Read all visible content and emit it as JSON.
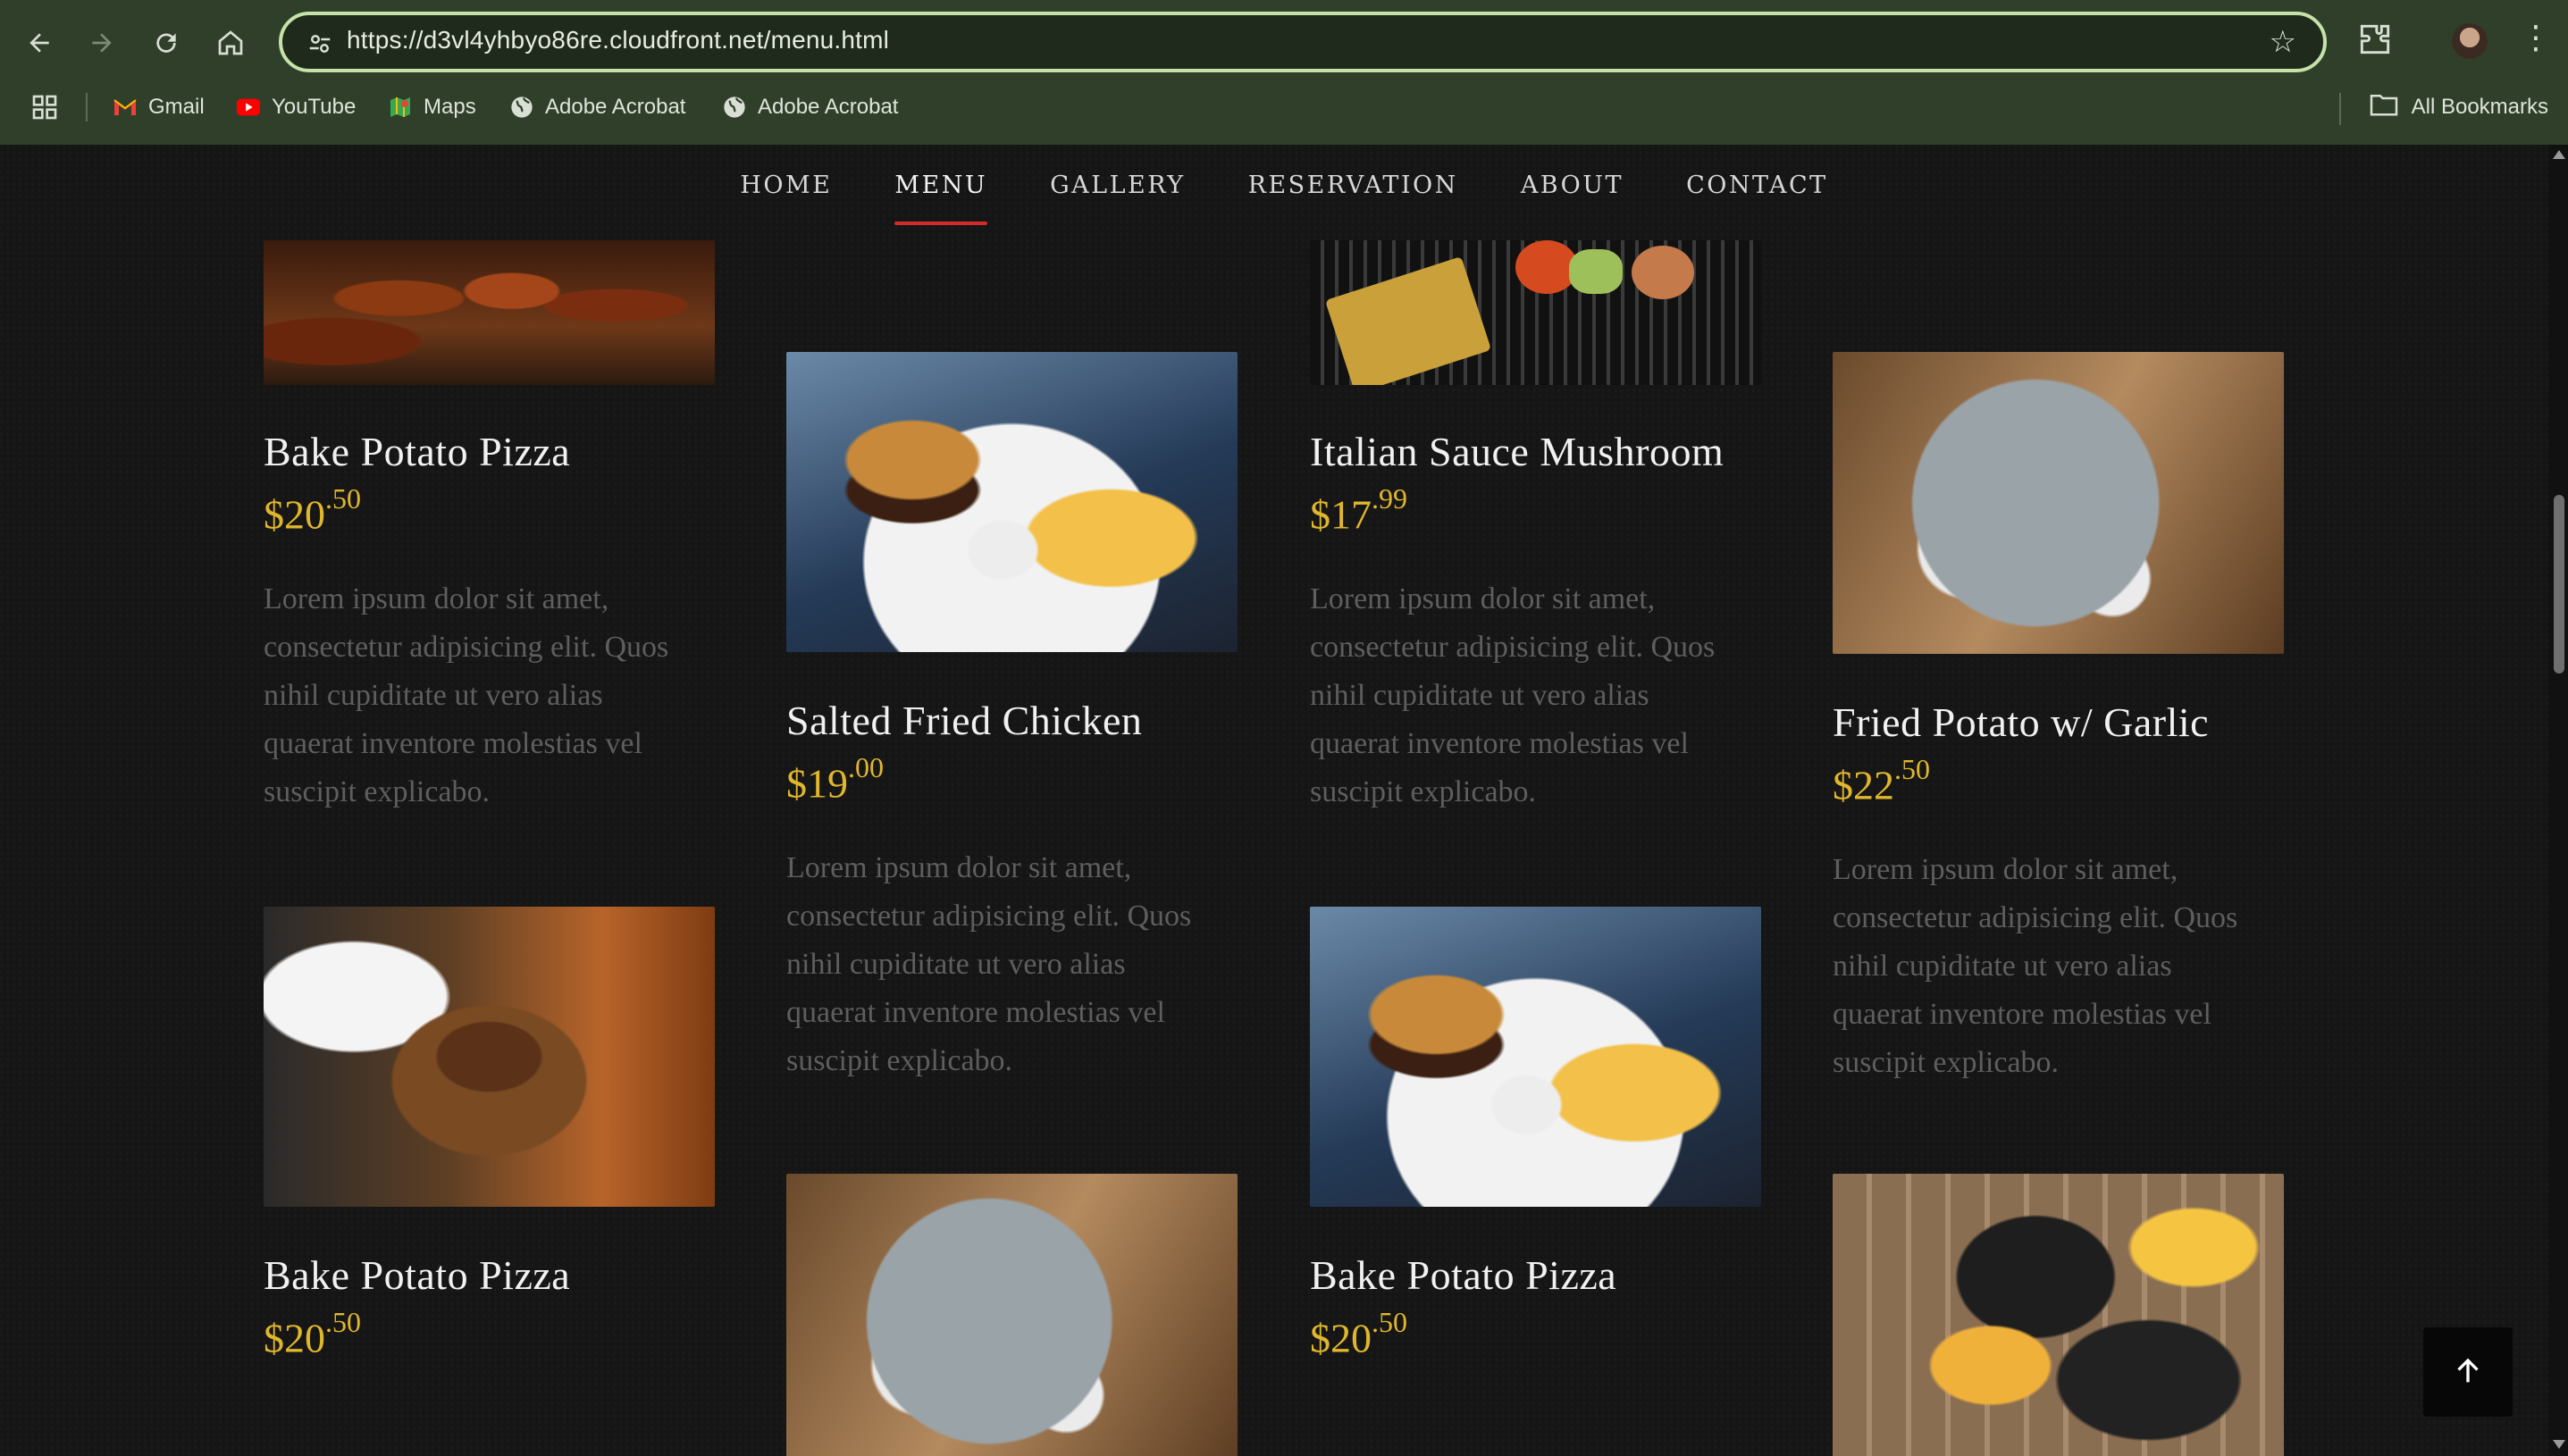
{
  "browser": {
    "url": "https://d3vl4yhbyo86re.cloudfront.net/menu.html",
    "bookmarks": [
      {
        "label": "Gmail",
        "icon": "gmail-icon"
      },
      {
        "label": "YouTube",
        "icon": "youtube-icon"
      },
      {
        "label": "Maps",
        "icon": "maps-icon"
      },
      {
        "label": "Adobe Acrobat",
        "icon": "globe-icon"
      },
      {
        "label": "Adobe Acrobat",
        "icon": "globe-icon"
      }
    ],
    "all_bookmarks": "All Bookmarks"
  },
  "nav": {
    "items": [
      "HOME",
      "MENU",
      "GALLERY",
      "RESERVATION",
      "ABOUT",
      "CONTACT"
    ],
    "active": "MENU"
  },
  "description": "Lorem ipsum dolor sit amet, consectetur adipisicing elit. Quos nihil cupiditate ut vero alias quaerat inventore molestias vel suscipit explicabo.",
  "desc_lines": [
    "Lorem ipsum dolor sit amet,",
    "consectetur adipisicing elit. Quos",
    "nihil cupiditate ut vero alias",
    "quaerat inventore molestias vel",
    "suscipit explicabo."
  ],
  "menu": [
    {
      "name": "Bake Potato Pizza",
      "price_main": "$20",
      "price_cents": ".50"
    },
    {
      "name": "Salted Fried Chicken",
      "price_main": "$19",
      "price_cents": ".00"
    },
    {
      "name": "Italian Sauce Mushroom",
      "price_main": "$17",
      "price_cents": ".99"
    },
    {
      "name": "Fried Potato w/ Garlic",
      "price_main": "$22",
      "price_cents": ".50"
    },
    {
      "name": "Bake Potato Pizza",
      "price_main": "$20",
      "price_cents": ".50"
    },
    {
      "name": "Bake Potato Pizza",
      "price_main": "$20",
      "price_cents": ".50"
    }
  ],
  "colors": {
    "accent_red": "#d32b2b",
    "price_gold": "#e0b72c",
    "omnibox_border": "#c6e2a9"
  }
}
